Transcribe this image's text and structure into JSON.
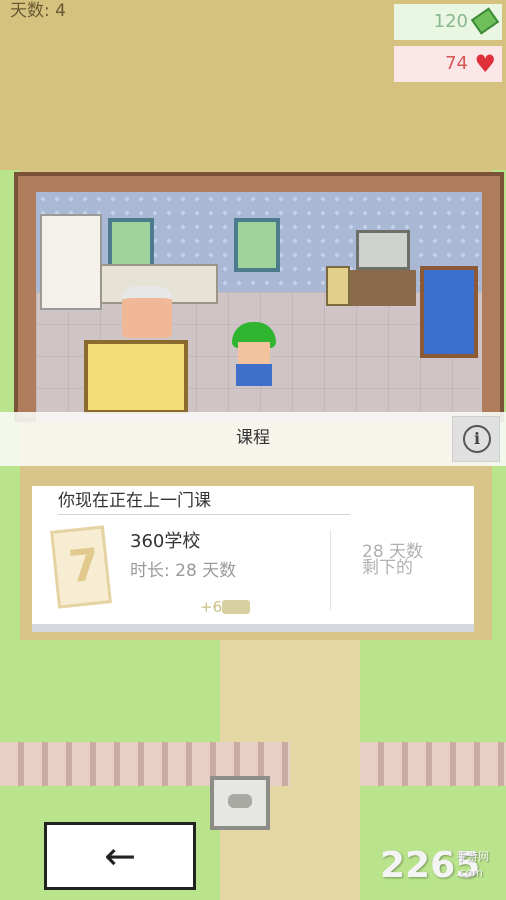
{
  "hud": {
    "days_label": "天数: 4",
    "money": "120",
    "money_icon": "cash-icon",
    "health": "74",
    "health_icon": "heart-icon"
  },
  "panel": {
    "title": "课程",
    "info_icon": "info-icon",
    "info_symbol": "i"
  },
  "course_card": {
    "heading": "你现在正在上一门课",
    "name": "360学校",
    "duration": "时长: 28 天数",
    "reward": "+6",
    "reward_icon": "gamepad-icon",
    "days_left_value": "28 天数",
    "days_left_label": "剩下的",
    "icon": "clipboard-icon",
    "icon_mark": "7"
  },
  "nav": {
    "back_symbol": "←"
  },
  "watermark": {
    "brand": "2265",
    "sub": "手游网",
    "domain": ".com"
  },
  "colors": {
    "money_text": "#8ab78b",
    "health_text": "#d75656",
    "heart": "#e0303a",
    "reward_text": "#c9c084"
  }
}
